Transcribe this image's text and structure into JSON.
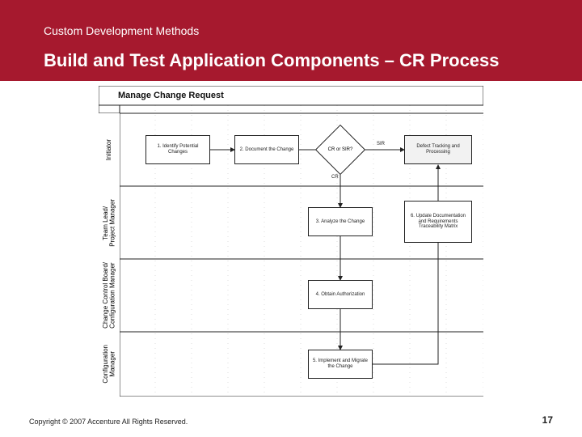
{
  "header": {
    "eyebrow": "Custom Development Methods",
    "title": "Build and Test Application Components – CR Process"
  },
  "footer": {
    "copyright": "Copyright © 2007 Accenture All Rights Reserved.",
    "page": "17"
  },
  "diagram": {
    "title": "Manage Change Request",
    "lanes": [
      {
        "name": "Initiator"
      },
      {
        "name": "Team Lead/\nProject Manager"
      },
      {
        "name": "Change Control Board/\nConfiguration Manager"
      },
      {
        "name": "Configuration\nManager"
      }
    ],
    "boxes": {
      "b1": "1. Identify\nPotential Changes",
      "b2": "2. Document the\nChange",
      "d1": "CR or SIR?",
      "b3": "Defect Tracking\nand Processing",
      "b4": "3. Analyze the\nChange",
      "b5": "6. Update\nDocumentation\nand Requirements\nTraceability Matrix",
      "b6": "4. Obtain\nAuthorization",
      "b7": "5. Implement and\nMigrate the\nChange"
    },
    "labels": {
      "sir": "SIR",
      "cr": "CR"
    }
  }
}
